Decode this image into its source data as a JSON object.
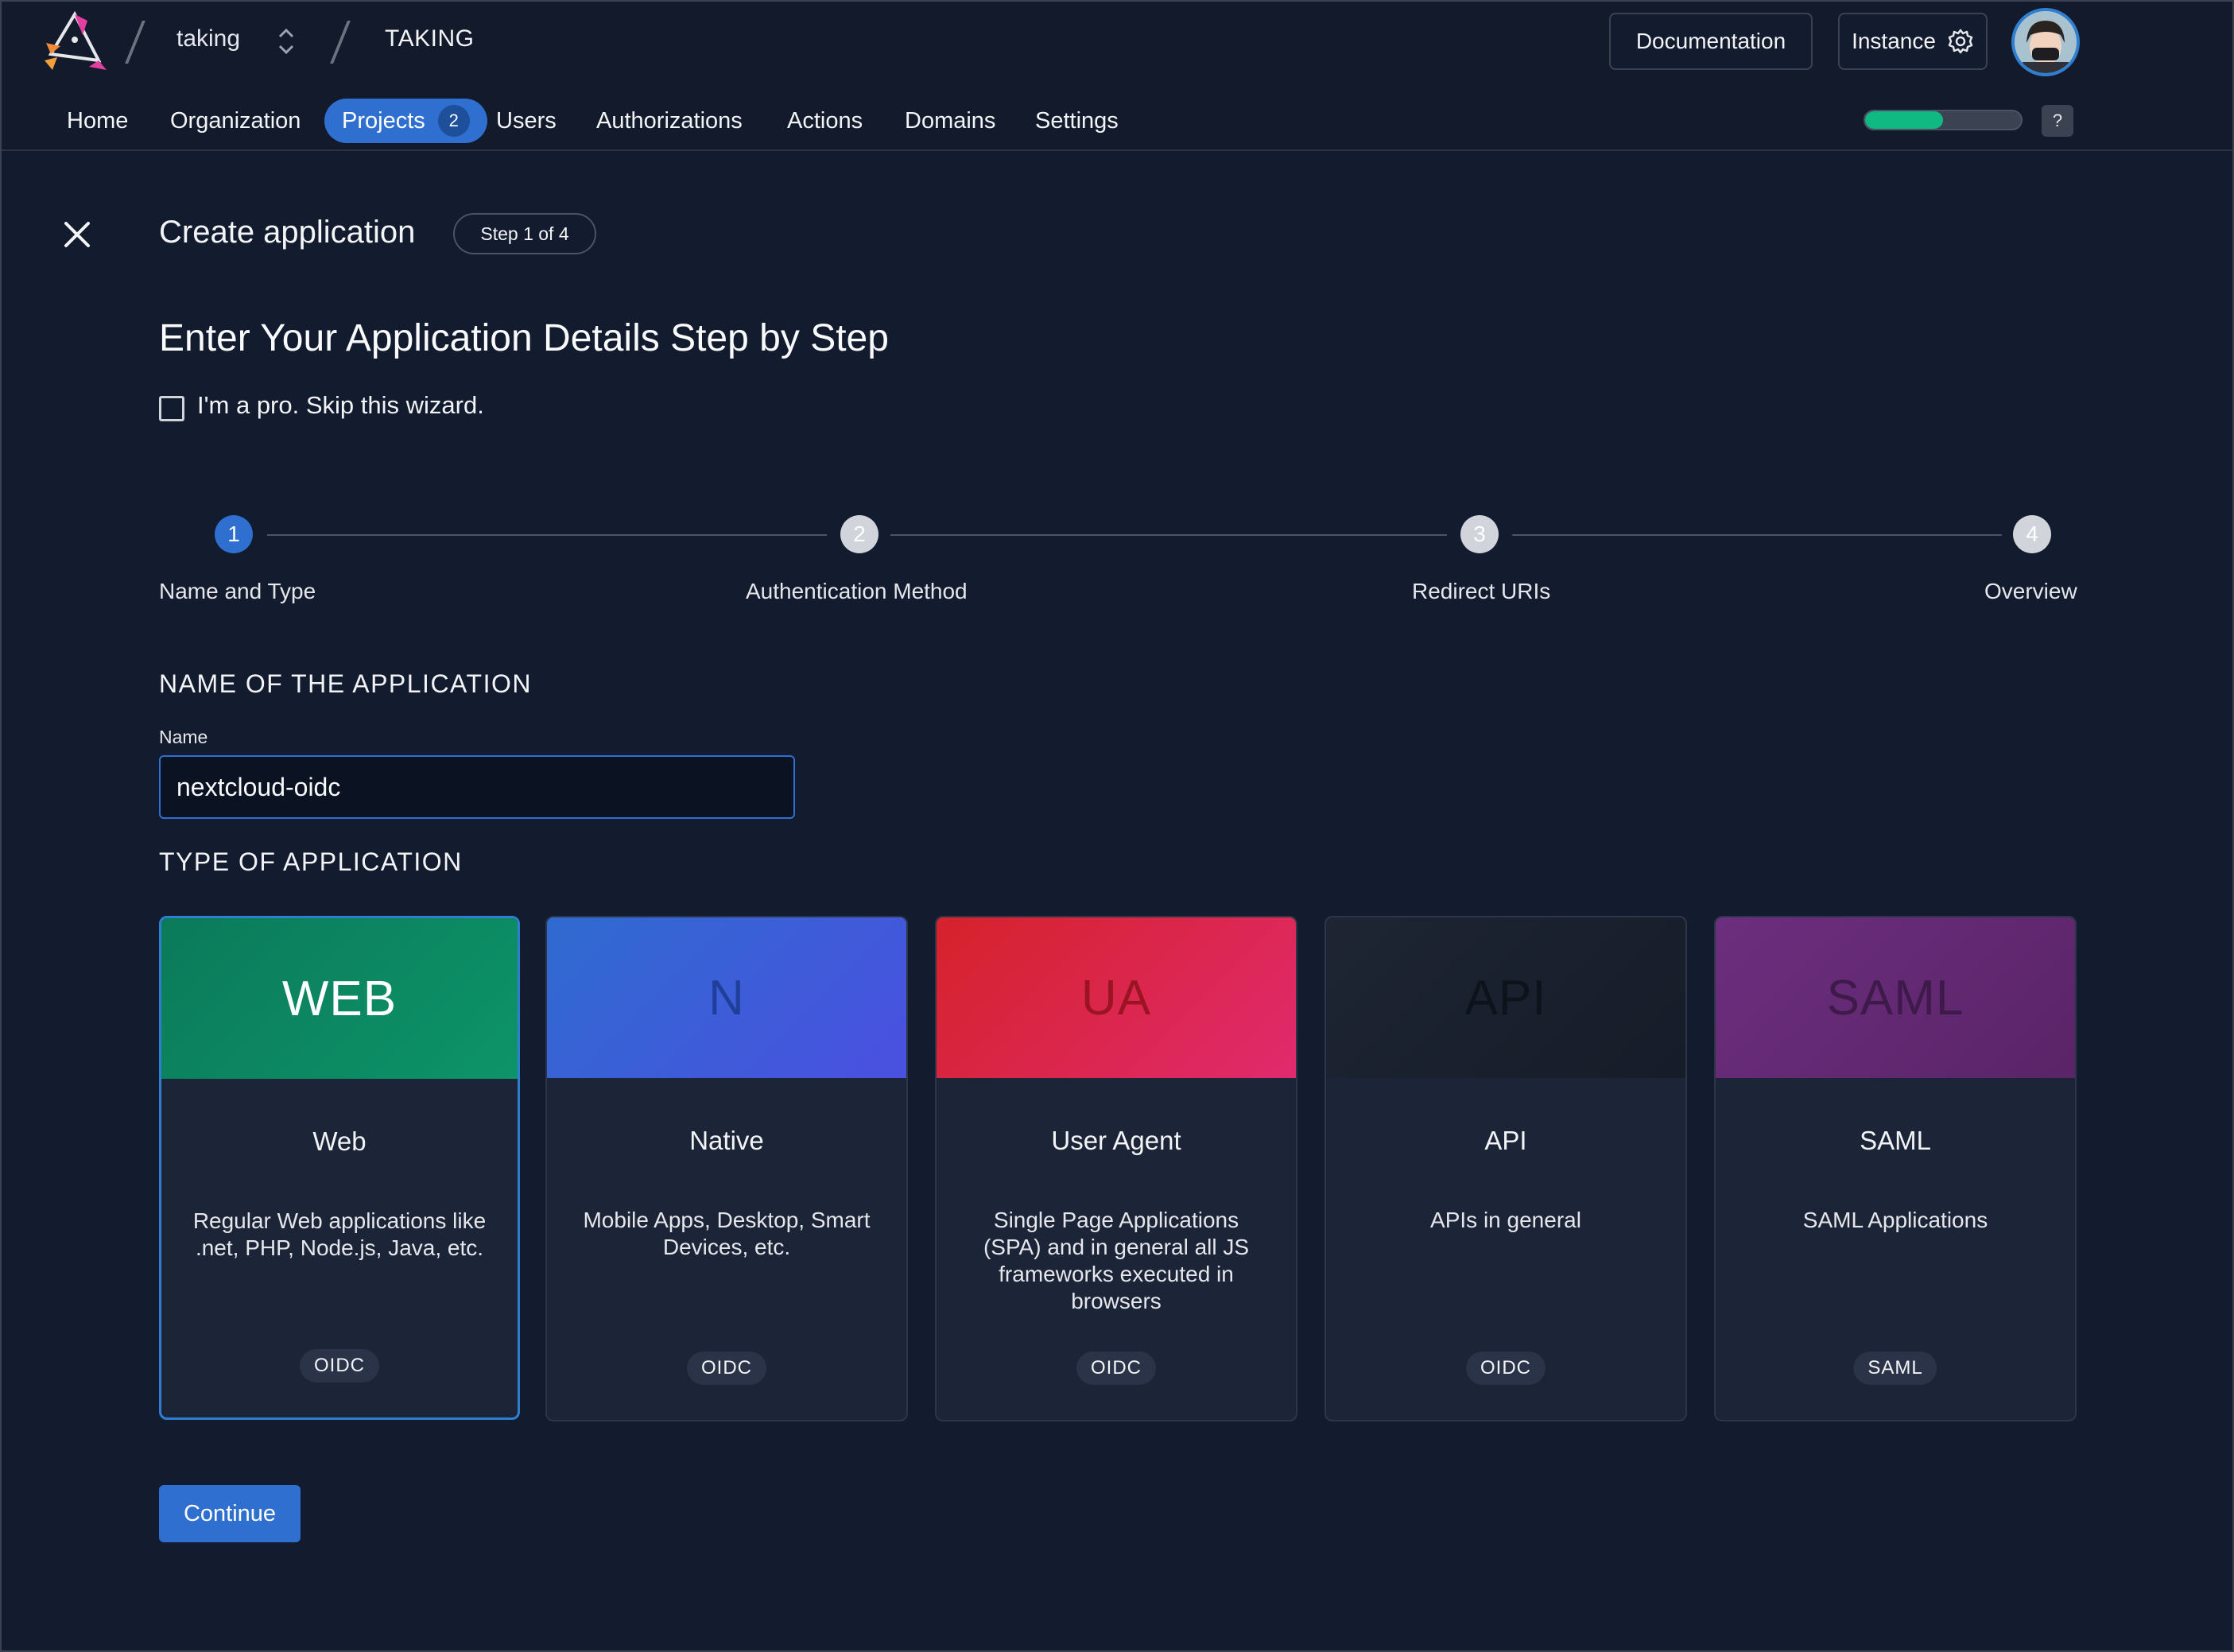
{
  "header": {
    "org_name": "taking",
    "instance_name": "TAKING",
    "documentation_label": "Documentation",
    "instance_label": "Instance"
  },
  "nav": {
    "home": "Home",
    "organization": "Organization",
    "projects": "Projects",
    "projects_count": "2",
    "users": "Users",
    "authorizations": "Authorizations",
    "actions": "Actions",
    "domains": "Domains",
    "settings": "Settings",
    "help": "?",
    "onboarding_progress": 0.5
  },
  "main": {
    "title": "Create application",
    "step_indicator": "Step 1 of 4",
    "heading": "Enter Your Application Details Step by Step",
    "skip_label": "I'm a pro. Skip this wizard.",
    "steps": [
      {
        "number": "1",
        "label": "Name and Type"
      },
      {
        "number": "2",
        "label": "Authentication Method"
      },
      {
        "number": "3",
        "label": "Redirect URIs"
      },
      {
        "number": "4",
        "label": "Overview"
      }
    ],
    "name_section_title": "NAME OF THE APPLICATION",
    "name_field_label": "Name",
    "name_value": "nextcloud-oidc",
    "type_section_title": "TYPE OF APPLICATION",
    "app_types": [
      {
        "abbr": "WEB",
        "name": "Web",
        "description": "Regular Web applications like .net, PHP, Node.js, Java, etc.",
        "tag": "OIDC"
      },
      {
        "abbr": "N",
        "name": "Native",
        "description": "Mobile Apps, Desktop, Smart Devices, etc.",
        "tag": "OIDC"
      },
      {
        "abbr": "UA",
        "name": "User Agent",
        "description": "Single Page Applications (SPA) and in general all JS frameworks executed in browsers",
        "tag": "OIDC"
      },
      {
        "abbr": "API",
        "name": "API",
        "description": "APIs in general",
        "tag": "OIDC"
      },
      {
        "abbr": "SAML",
        "name": "SAML",
        "description": "SAML Applications",
        "tag": "SAML"
      }
    ],
    "continue_label": "Continue"
  },
  "colors": {
    "accent": "#2f6fd0",
    "web_head": "#0b8a60",
    "native_head": "#3f5fd8",
    "ua_head": "#e02a3a",
    "api_head": "#1b2130",
    "saml_head": "#6a2a78",
    "progress": "#10b981"
  }
}
